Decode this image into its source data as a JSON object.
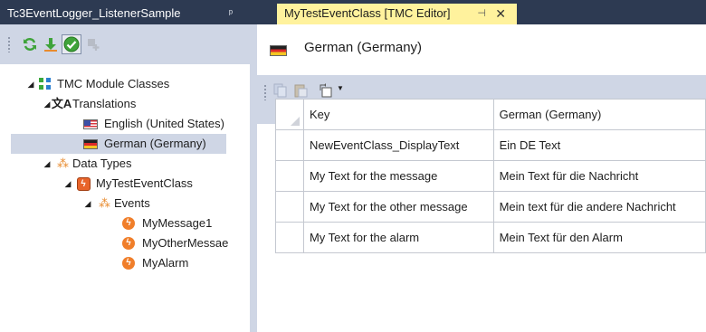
{
  "tabs": {
    "left": {
      "title": "Tc3EventLogger_ListenerSample",
      "pin": "ᵖ"
    },
    "right": {
      "title": "MyTestEventClass [TMC Editor]",
      "pin": "⊣",
      "close": "✕"
    }
  },
  "toolbar_icons": [
    "refresh-icon",
    "download-icon",
    "check-icon",
    "add-icon"
  ],
  "tree": {
    "root": "TMC Module Classes",
    "translations": "Translations",
    "lang_en": "English (United States)",
    "lang_de": "German (Germany)",
    "data_types": "Data Types",
    "event_class": "MyTestEventClass",
    "events": "Events",
    "event1": "MyMessage1",
    "event2": "MyOtherMessae",
    "event3": "MyAlarm"
  },
  "editor": {
    "title": "German (Germany)",
    "columns": {
      "key": "Key",
      "value": "German (Germany)"
    },
    "rows": [
      {
        "key": "NewEventClass_DisplayText",
        "value": "Ein DE Text"
      },
      {
        "key": "My Text for the message",
        "value": "Mein Text für die Nachricht"
      },
      {
        "key": "My Text for the other message",
        "value": "Mein text für die andere Nachricht"
      },
      {
        "key": "My Text for the alarm",
        "value": "Mein Text für den Alarm"
      }
    ]
  },
  "colors": {
    "tab_bar": "#2d3a52",
    "active_tab": "#fff29d",
    "panel": "#cfd6e5"
  }
}
